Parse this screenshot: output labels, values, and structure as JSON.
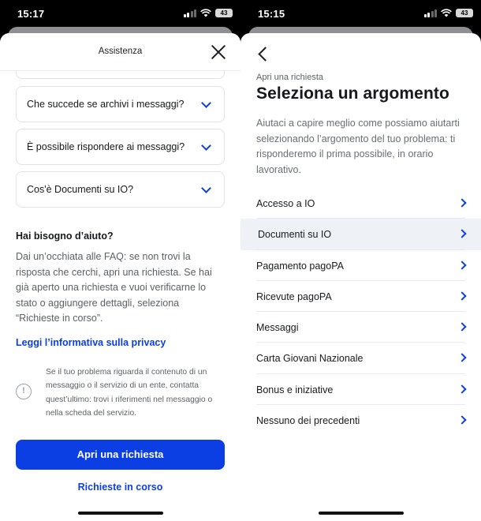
{
  "left": {
    "status": {
      "time": "15:17",
      "battery": "43"
    },
    "sheet_title": "Assistenza",
    "faqs": [
      {
        "question": "Che succede se archivi i messaggi?"
      },
      {
        "question": "È possibile rispondere ai messaggi?"
      },
      {
        "question": "Cos'è Documenti su IO?"
      }
    ],
    "help": {
      "title": "Hai bisogno d’aiuto?",
      "text": "Dai un’occhiata alle FAQ: se non trovi la risposta che cerchi, apri una richiesta. Se hai già aperto una richiesta e vuoi verificarne lo stato o aggiungere dettagli, seleziona “Richieste in corso”."
    },
    "privacy_link": "Leggi l’informativa sulla privacy",
    "info_text": "Se il tuo problema riguarda il contenuto di un messaggio o il servizio di un ente, contatta quest’ultimo: trovi i riferimenti nel messaggio o nella scheda del servizio.",
    "primary_button": "Apri una richiesta",
    "secondary_link": "Richieste in corso"
  },
  "right": {
    "status": {
      "time": "15:15",
      "battery": "43"
    },
    "breadcrumb": "Apri una richiesta",
    "title": "Seleziona un argomento",
    "description": "Aiutaci a capire meglio come possiamo aiutarti selezionando l’argomento del tuo problema: ti risponderemo il prima possibile, in orario lavorativo.",
    "topics": [
      {
        "label": "Accesso a IO"
      },
      {
        "label": "Documenti su IO"
      },
      {
        "label": "Pagamento pagoPA"
      },
      {
        "label": "Ricevute pagoPA"
      },
      {
        "label": "Messaggi"
      },
      {
        "label": "Carta Giovani Nazionale"
      },
      {
        "label": "Bonus e iniziative"
      },
      {
        "label": "Nessuno dei precedenti"
      }
    ]
  },
  "icons": {
    "close": "close-icon",
    "back": "chevron-left-icon",
    "expand": "chevron-down-icon",
    "forward": "chevron-right-icon",
    "info": "info-icon"
  },
  "colors": {
    "accent": "#0b3ee3",
    "text": "#17191d",
    "muted": "#5c6066",
    "selected_row": "#eef1f6"
  }
}
